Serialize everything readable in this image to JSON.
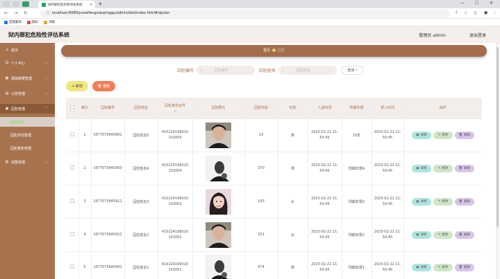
{
  "browser": {
    "tab_title": "狱内罪犯危险性评估系统",
    "url": "localhost:8080/yuneifengxianpinggu/admin/dist/index.html#/qiufan",
    "bookmarks": [
      {
        "label": "百度翻译",
        "color": "#2f6fe4"
      },
      {
        "label": "图标",
        "color": "#e74c3c"
      },
      {
        "label": "顶级",
        "color": "#e8a33b"
      }
    ]
  },
  "header": {
    "title": "狱内罪犯危险性评估系统",
    "user": "管理员 admin",
    "logout": "退出登录"
  },
  "sidebar": {
    "items": [
      {
        "label": "首页",
        "icon": "home-icon"
      },
      {
        "label": "个人中心",
        "icon": "person-icon"
      },
      {
        "label": "基础数据管理",
        "icon": "grid-icon"
      },
      {
        "label": "公告管理",
        "icon": "notice-icon"
      },
      {
        "label": "囚犯管理",
        "icon": "prisoner-icon"
      },
      {
        "label": "囚犯管理",
        "icon": ""
      },
      {
        "label": "囚犯评估管理",
        "icon": ""
      },
      {
        "label": "囚犯表彰管理",
        "icon": ""
      },
      {
        "label": "狱警管理",
        "icon": "guard-icon"
      }
    ]
  },
  "breadcrumb": {
    "first": "首页",
    "second": "囚犯"
  },
  "search": {
    "label1": "囚犯编号",
    "placeholder1": "囚犯编号",
    "label2": "囚犯姓名",
    "placeholder2": "囚犯姓名",
    "button": "查询"
  },
  "actions": {
    "add": "新增",
    "delete": "删除"
  },
  "table": {
    "headers": [
      "索引",
      "囚犯编号",
      "囚犯姓名",
      "囚犯身份证号",
      "囚犯照片",
      "囚犯年龄",
      "性别",
      "入监时间",
      "刑期年限",
      "录入时间",
      "操作"
    ],
    "rows": [
      {
        "idx": "1",
        "code": "1677073845902",
        "name": "囚犯姓名5",
        "id1": "410224199010",
        "id2": "102005",
        "age": "23",
        "gender": "男",
        "in1": "2023-02-22 21:",
        "in2": "50:45",
        "term": "10年",
        "rec1": "2023-02-22 21:",
        "rec2": "50:45",
        "photo": "man"
      },
      {
        "idx": "2",
        "code": "1677073845900",
        "name": "囚犯姓名4",
        "id1": "410224199010",
        "id2": "102004",
        "age": "370",
        "gender": "男",
        "in1": "2023-02-22 21:",
        "in2": "50:45",
        "term": "刑期年限4",
        "rec1": "2023-02-22 21:",
        "rec2": "50:45",
        "photo": "bw"
      },
      {
        "idx": "3",
        "code": "1677073845911",
        "name": "囚犯姓名3",
        "id1": "410224199010",
        "id2": "102003",
        "age": "163",
        "gender": "女",
        "in1": "2023-02-22 21:",
        "in2": "50:45",
        "term": "刑期年限3",
        "rec1": "2023-02-22 21:",
        "rec2": "50:45",
        "photo": "woman"
      },
      {
        "idx": "4",
        "code": "1677073845922",
        "name": "囚犯姓名2",
        "id1": "410224199010",
        "id2": "102002",
        "age": "251",
        "gender": "女",
        "in1": "2023-02-22 21:",
        "in2": "50:45",
        "term": "刑期年限2",
        "rec1": "2023-02-22 21:",
        "rec2": "50:45",
        "photo": "man"
      },
      {
        "idx": "5",
        "code": "1677073845941",
        "name": "囚犯姓名1",
        "id1": "410224199010",
        "id2": "102001",
        "age": "474",
        "gender": "男",
        "in1": "2023-02-22 21:",
        "in2": "50:45",
        "term": "刑期年限1",
        "rec1": "2023-02-22 21:",
        "rec2": "50:45",
        "photo": "bw"
      }
    ],
    "ops": {
      "detail": "详情",
      "edit": "修改",
      "delete": "删除"
    }
  }
}
